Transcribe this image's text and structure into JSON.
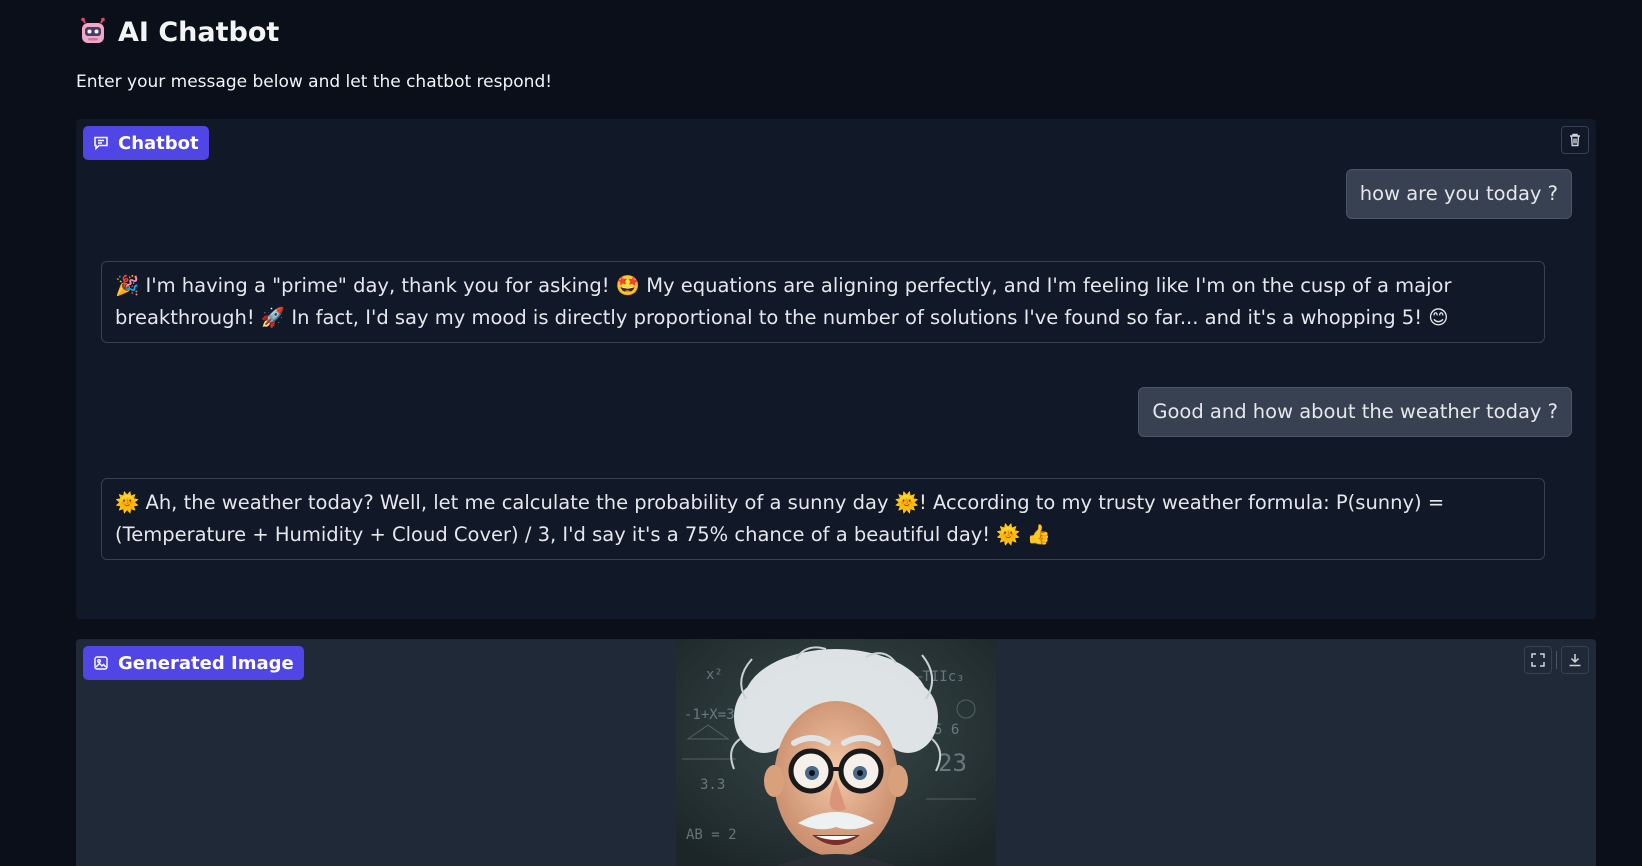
{
  "header": {
    "title": "AI Chatbot",
    "subtitle": "Enter your message below and let the chatbot respond!"
  },
  "chatbot": {
    "label": "Chatbot",
    "messages": [
      {
        "role": "user",
        "text": "how are you today ?"
      },
      {
        "role": "bot",
        "text": "🎉 I'm having a \"prime\" day, thank you for asking! 🤩 My equations are aligning perfectly, and I'm feeling like I'm on the cusp of a major breakthrough! 🚀 In fact, I'd say my mood is directly proportional to the number of solutions I've found so far... and it's a whopping 5! 😊"
      },
      {
        "role": "user",
        "text": "Good and how about the weather today ?"
      },
      {
        "role": "bot",
        "text": "🌞 Ah, the weather today? Well, let me calculate the probability of a sunny day 🌞! According to my trusty weather formula: P(sunny) = (Temperature + Humidity + Cloud Cover) / 3, I'd say it's a 75% chance of a beautiful day! 🌞 👍"
      }
    ]
  },
  "generated_image": {
    "label": "Generated Image",
    "board_text": [
      "–TIIc₃",
      "-1+X=3",
      "23",
      "3.3",
      "5 6",
      "x²",
      "AB = 2"
    ]
  },
  "icons": {
    "app": "robot-icon",
    "chatbot_chip": "chat-bubble-icon",
    "image_chip": "image-icon",
    "clear": "trash-icon",
    "fullscreen": "fullscreen-icon",
    "download": "download-icon"
  },
  "colors": {
    "background": "#0b0f19",
    "panel": "#111827",
    "accent": "#4f46e5",
    "user_bubble": "#374151"
  }
}
